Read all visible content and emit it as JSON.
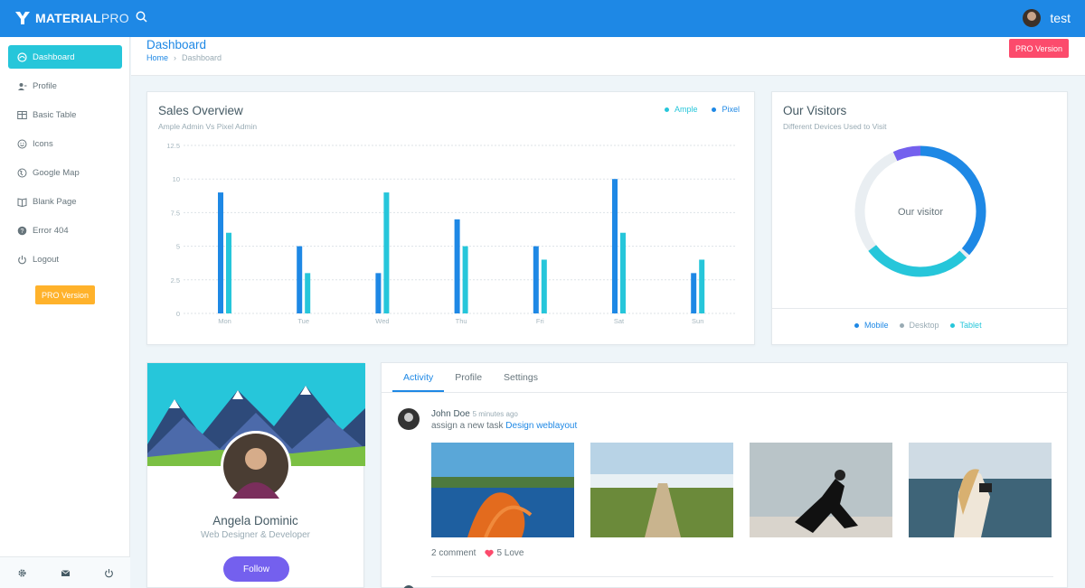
{
  "brand": {
    "bold": "MATERIAL",
    "light": "PRO"
  },
  "topbar": {
    "user_name": "test"
  },
  "sidebar": {
    "items": [
      {
        "label": "Dashboard",
        "icon": "dashboard-icon"
      },
      {
        "label": "Profile",
        "icon": "user-icon"
      },
      {
        "label": "Basic Table",
        "icon": "table-icon"
      },
      {
        "label": "Icons",
        "icon": "smiley-icon"
      },
      {
        "label": "Google Map",
        "icon": "globe-icon"
      },
      {
        "label": "Blank Page",
        "icon": "book-icon"
      },
      {
        "label": "Error 404",
        "icon": "help-icon"
      },
      {
        "label": "Logout",
        "icon": "power-icon"
      }
    ],
    "pro_label": "PRO Version",
    "footer_icons": [
      "gear-icon",
      "mail-icon",
      "power-icon"
    ]
  },
  "header": {
    "title": "Dashboard",
    "breadcrumb_home": "Home",
    "breadcrumb_current": "Dashboard",
    "pro_label": "PRO Version"
  },
  "sales": {
    "title": "Sales Overview",
    "subtitle": "Ample Admin Vs Pixel Admin"
  },
  "chart_data": {
    "type": "bar",
    "categories": [
      "Mon",
      "Tue",
      "Wed",
      "Thu",
      "Fri",
      "Sat",
      "Sun"
    ],
    "series": [
      {
        "name": "Ample",
        "values": [
          9,
          5,
          3,
          7,
          5,
          10,
          3
        ],
        "color": "#1e88e5"
      },
      {
        "name": "Pixel",
        "values": [
          6,
          3,
          9,
          5,
          4,
          6,
          4
        ],
        "color": "#26c6da"
      }
    ],
    "yticks": [
      "0",
      "2.5",
      "5",
      "7.5",
      "10",
      "12.5"
    ],
    "ylim": [
      0,
      12.5
    ],
    "legend": "top-right",
    "grid": true
  },
  "visitors": {
    "title": "Our Visitors",
    "subtitle": "Different Devices Used to Visit",
    "center_label": "Our visitor",
    "legend": [
      {
        "label": "Mobile",
        "color": "#1e88e5"
      },
      {
        "label": "Desktop",
        "color": "#99abb4"
      },
      {
        "label": "Tablet",
        "color": "#26c6da"
      }
    ]
  },
  "profile": {
    "name": "Angela Dominic",
    "role": "Web Designer & Developer",
    "follow_label": "Follow"
  },
  "activity": {
    "tabs": [
      "Activity",
      "Profile",
      "Settings"
    ],
    "author": "John Doe",
    "time": "5 minutes ago",
    "text": "assign a new task",
    "link": "Design weblayout",
    "comments": "2 comment",
    "loves": "5 Love"
  },
  "colors": {
    "primary": "#1e88e5",
    "info": "#26c6da",
    "warning": "#ffb22b",
    "danger": "#fc4b6c",
    "purple": "#7460ee"
  }
}
